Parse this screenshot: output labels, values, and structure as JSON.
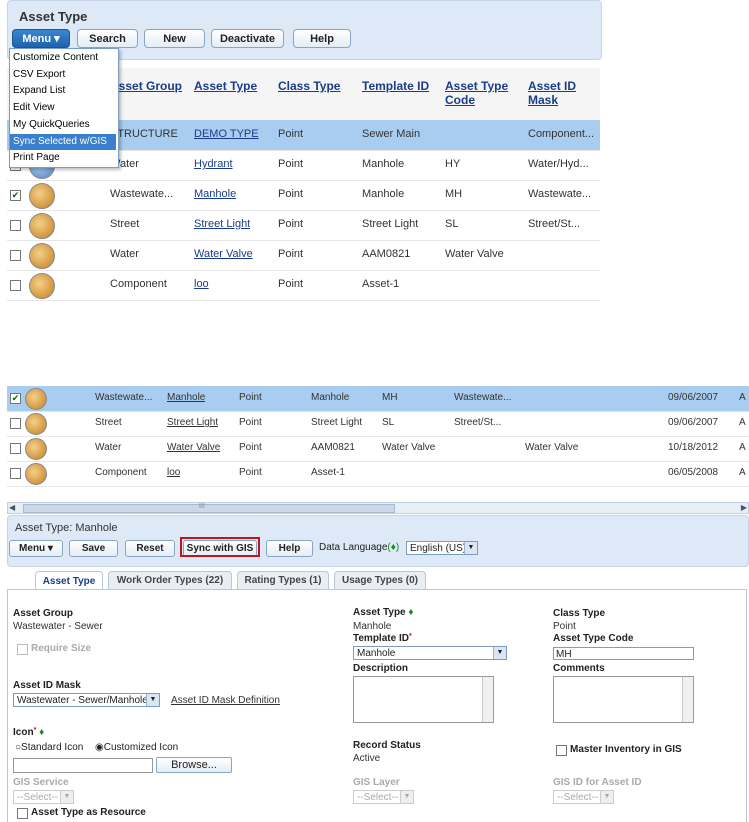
{
  "panel1": {
    "title": "Asset Type",
    "toolbar": {
      "menu": "Menu ▾",
      "search": "Search",
      "new": "New",
      "deactivate": "Deactivate",
      "help": "Help"
    },
    "menu_items": [
      "Customize Content",
      "CSV Export",
      "Expand List",
      "Edit View",
      "My QuickQueries",
      "Sync Selected w/GIS",
      "Print Page"
    ],
    "menu_selected_index": 5,
    "columns": {
      "asset_group": "Asset Group",
      "asset_type": "Asset Type",
      "class_type": "Class Type",
      "template_id": "Template ID",
      "type_code_1": "Asset Type",
      "type_code_2": "Code",
      "mask_1": "Asset ID",
      "mask_2": "Mask"
    },
    "rows": [
      {
        "checked": false,
        "selected": true,
        "group": "STRUCTURE",
        "type": "DEMO TYPE",
        "class": "Point",
        "template": "Sewer Main",
        "code": "",
        "mask": "Component..."
      },
      {
        "checked": false,
        "selected": false,
        "group": "Water",
        "type": "Hydrant",
        "class": "Point",
        "template": "Manhole",
        "code": "HY",
        "mask": "Water/Hyd..."
      },
      {
        "checked": true,
        "selected": false,
        "group": "Wastewate...",
        "type": "Manhole",
        "class": "Point",
        "template": "Manhole",
        "code": "MH",
        "mask": "Wastewate..."
      },
      {
        "checked": false,
        "selected": false,
        "group": "Street",
        "type": "Street Light",
        "class": "Point",
        "template": "Street Light",
        "code": "SL",
        "mask": "Street/St..."
      },
      {
        "checked": false,
        "selected": false,
        "group": "Water",
        "type": "Water Valve",
        "class": "Point",
        "template": "AAM0821",
        "code": "Water Valve",
        "mask": ""
      },
      {
        "checked": false,
        "selected": false,
        "group": "Component",
        "type": "loo",
        "class": "Point",
        "template": "Asset-1",
        "code": "",
        "mask": ""
      }
    ]
  },
  "panel2": {
    "rows": [
      {
        "checked": true,
        "selected": true,
        "group": "Wastewate...",
        "type": "Manhole",
        "class": "Point",
        "template": "Manhole",
        "code": "MH",
        "mask": "Wastewate...",
        "extra": "",
        "date": "09/06/2007",
        "last": "A"
      },
      {
        "checked": false,
        "selected": false,
        "group": "Street",
        "type": "Street Light",
        "class": "Point",
        "template": "Street Light",
        "code": "SL",
        "mask": "Street/St...",
        "extra": "",
        "date": "09/06/2007",
        "last": "A"
      },
      {
        "checked": false,
        "selected": false,
        "group": "Water",
        "type": "Water Valve",
        "class": "Point",
        "template": "AAM0821",
        "code": "Water Valve",
        "mask": "",
        "extra": "Water Valve",
        "date": "10/18/2012",
        "last": "A"
      },
      {
        "checked": false,
        "selected": false,
        "group": "Component",
        "type": "loo",
        "class": "Point",
        "template": "Asset-1",
        "code": "",
        "mask": "",
        "extra": "",
        "date": "06/05/2008",
        "last": "A"
      }
    ],
    "scroll_grip": "III",
    "title": "Asset Type: Manhole",
    "toolbar": {
      "menu": "Menu ▾",
      "save": "Save",
      "reset": "Reset",
      "sync": "Sync with GIS",
      "help": "Help",
      "data_language": "Data Language",
      "language_value": "English (US)"
    },
    "tabs": [
      "Asset Type",
      "Work Order Types (22)",
      "Rating Types (1)",
      "Usage Types (0)"
    ],
    "form": {
      "asset_group_label": "Asset Group",
      "asset_group_value": "Wastewater - Sewer",
      "require_size": "Require Size",
      "asset_id_mask_label": "Asset ID Mask",
      "asset_id_mask_value": "Wastewater - Sewer/Manhole",
      "asset_id_mask_def": "Asset ID Mask Definition",
      "icon_label": "Icon",
      "standard_icon": "Standard Icon",
      "customized_icon": "Customized Icon",
      "browse": "Browse...",
      "gis_service_label": "GIS Service",
      "select_placeholder": "--Select--",
      "asset_type_as_resource": "Asset Type as Resource",
      "asset_type_label": "Asset Type",
      "asset_type_value": "Manhole",
      "template_id_label": "Template ID",
      "template_id_value": "Manhole",
      "description_label": "Description",
      "record_status_label": "Record Status",
      "record_status_value": "Active",
      "gis_layer_label": "GIS Layer",
      "class_type_label": "Class Type",
      "class_type_value": "Point",
      "asset_type_code_label": "Asset Type Code",
      "asset_type_code_value": "MH",
      "comments_label": "Comments",
      "master_inventory": "Master Inventory in GIS",
      "gis_id_label": "GIS ID for Asset ID"
    }
  }
}
